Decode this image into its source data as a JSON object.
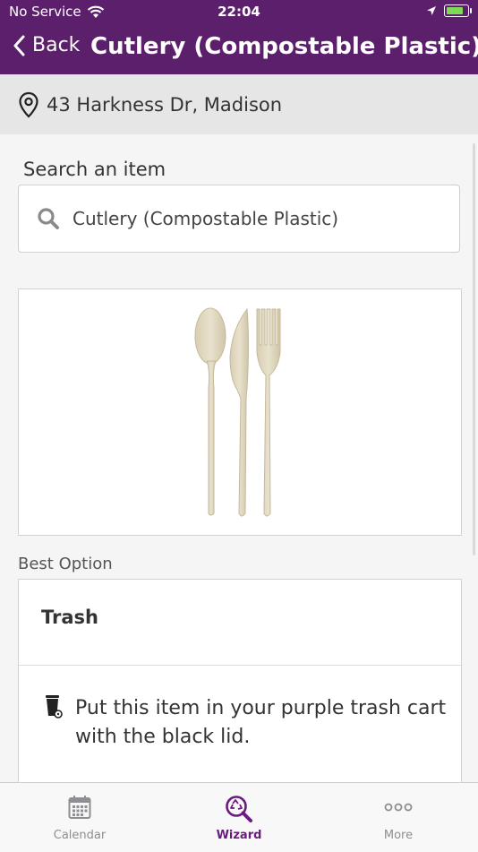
{
  "status_bar": {
    "carrier": "No Service",
    "time": "22:04"
  },
  "nav": {
    "back_label": "Back",
    "title": "Cutlery (Compostable Plastic)"
  },
  "location": {
    "address": "43 Harkness Dr, Madison"
  },
  "search": {
    "label": "Search an item",
    "value": "Cutlery (Compostable Plastic)"
  },
  "result": {
    "section_label": "Best Option",
    "option_title": "Trash",
    "instruction": "Put this item in your purple trash cart with the black lid."
  },
  "tabs": [
    {
      "label": "Calendar",
      "icon": "calendar-icon"
    },
    {
      "label": "Wizard",
      "icon": "wizard-recycle-search-icon"
    },
    {
      "label": "More",
      "icon": "more-icon"
    }
  ],
  "colors": {
    "brand_purple": "#5b1f6b",
    "active_tab": "#6a1b7d",
    "battery_fill": "#7ed957"
  }
}
